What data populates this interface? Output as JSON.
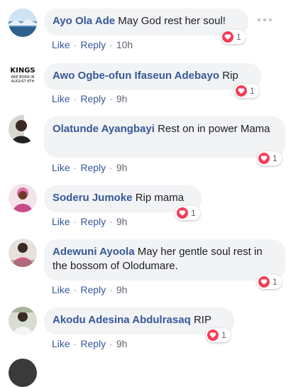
{
  "comments": [
    {
      "author": "Ayo Ola Ade",
      "text": "May God rest her soul!",
      "reactions": "1",
      "like": "Like",
      "reply": "Reply",
      "time": "10h",
      "avatar_icon": "avatar-landscape-icon"
    },
    {
      "author": "Awo Ogbe-ofun Ifaseun Adebayo",
      "text": "Rip",
      "reactions": "1",
      "like": "Like",
      "reply": "Reply",
      "time": "9h",
      "avatar_icon": "avatar-kings-logo-icon",
      "avatar_text": [
        "KINGS",
        "ARE BORN IN",
        "AUGUST 8TH"
      ]
    },
    {
      "author": "Olatunde Ayangbayi",
      "text": "Rest on in power Mama",
      "reactions": "1",
      "like": "Like",
      "reply": "Reply",
      "time": "9h",
      "avatar_icon": "avatar-photo-icon"
    },
    {
      "author": "Soderu Jumoke",
      "text": "Rip mama",
      "reactions": "1",
      "like": "Like",
      "reply": "Reply",
      "time": "9h",
      "avatar_icon": "avatar-photo-icon"
    },
    {
      "author": "Adewuni Ayoola",
      "text": "May her gentle soul rest in the bossom of Olodumare.",
      "reactions": "1",
      "like": "Like",
      "reply": "Reply",
      "time": "9h",
      "avatar_icon": "avatar-photo-icon"
    },
    {
      "author": "Akodu Adesina Abdulrasaq",
      "text": "RIP",
      "reactions": "1",
      "like": "Like",
      "reply": "Reply",
      "time": "9h",
      "avatar_icon": "avatar-photo-icon"
    }
  ],
  "colors": {
    "author": "#385898",
    "bubble": "#f2f3f5",
    "heart": "#f33e58",
    "meta": "#606770"
  }
}
